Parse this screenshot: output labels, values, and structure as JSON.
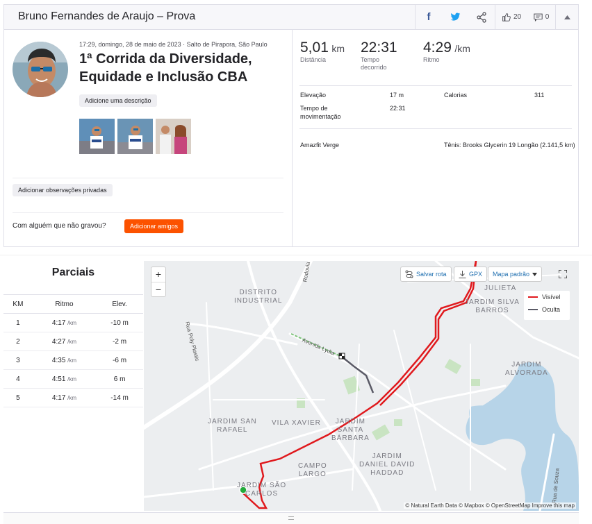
{
  "header": {
    "title": "Bruno Fernandes de Araujo – Prova",
    "kudos_count": "20",
    "comments_count": "0"
  },
  "activity": {
    "meta": "17:29, domingo, 28 de maio de 2023 · Salto de Pirapora, São Paulo",
    "title": "1ª Corrida da Diversidade, Equidade e Inclusão CBA",
    "add_description": "Adicione uma descrição",
    "add_private_notes": "Adicionar observações privadas",
    "with_someone": "Com alguém que não gravou?",
    "add_friends": "Adicionar amigos"
  },
  "stats": {
    "distance_value": "5,01",
    "distance_unit": "km",
    "distance_label": "Distância",
    "elapsed_value": "22:31",
    "elapsed_label": "Tempo decorrido",
    "pace_value": "4:29",
    "pace_unit": "/km",
    "pace_label": "Ritmo",
    "elevation_label": "Elevação",
    "elevation_value": "17 m",
    "calories_label": "Calorias",
    "calories_value": "311",
    "moving_time_label": "Tempo de movimentação",
    "moving_time_value": "22:31",
    "device": "Amazfit Verge",
    "shoes": "Tênis: Brooks Glycerin 19 Longão (2.141,5 km)"
  },
  "splits": {
    "title": "Parciais",
    "headers": [
      "KM",
      "Ritmo",
      "Elev."
    ],
    "pace_unit": "/km",
    "rows": [
      {
        "km": "1",
        "pace": "4:17",
        "elev": "-10 m"
      },
      {
        "km": "2",
        "pace": "4:27",
        "elev": "-2 m"
      },
      {
        "km": "3",
        "pace": "4:35",
        "elev": "-6 m"
      },
      {
        "km": "4",
        "pace": "4:51",
        "elev": "6 m"
      },
      {
        "km": "5",
        "pace": "4:17",
        "elev": "-14 m"
      }
    ]
  },
  "map": {
    "zoom_in": "+",
    "zoom_out": "−",
    "save_route": "Salvar rota",
    "gpx": "GPX",
    "map_style": "Mapa padrão",
    "legend_visible": "Visível",
    "legend_hidden": "Oculta",
    "attribution": "© Natural Earth Data © Mapbox © OpenStreetMap Improve this map",
    "labels": {
      "distrito_1": "DISTRITO",
      "distrito_2": "INDUSTRIAL",
      "julieta": "JULIETA",
      "silva_1": "JARDIM SILVA",
      "silva_2": "BARROS",
      "alvorada_1": "JARDIM",
      "alvorada_2": "ALVORADA",
      "sanrafael_1": "JARDIM SAN",
      "sanrafael_2": "RAFAEL",
      "vilaxavier": "VILA XAVIER",
      "barbara_1": "JARDIM",
      "barbara_2": "SANTA",
      "barbara_3": "BÁRBARA",
      "daniel_1": "JARDIM",
      "daniel_2": "DANIEL DAVID",
      "daniel_3": "HADDAD",
      "campo_1": "CAMPO",
      "campo_2": "LARGO",
      "saocarlos_1": "JARDIM SÃO",
      "saocarlos_2": "CARLOS",
      "avenida": "Avenida Lydia",
      "rua_poly": "Rua Poly Plastic",
      "rodovia": "Rodovia",
      "souza": "Rua de Souza"
    },
    "colors": {
      "route": "#e0191d",
      "hidden": "#5a5a66",
      "accent": "#fc5200"
    }
  }
}
